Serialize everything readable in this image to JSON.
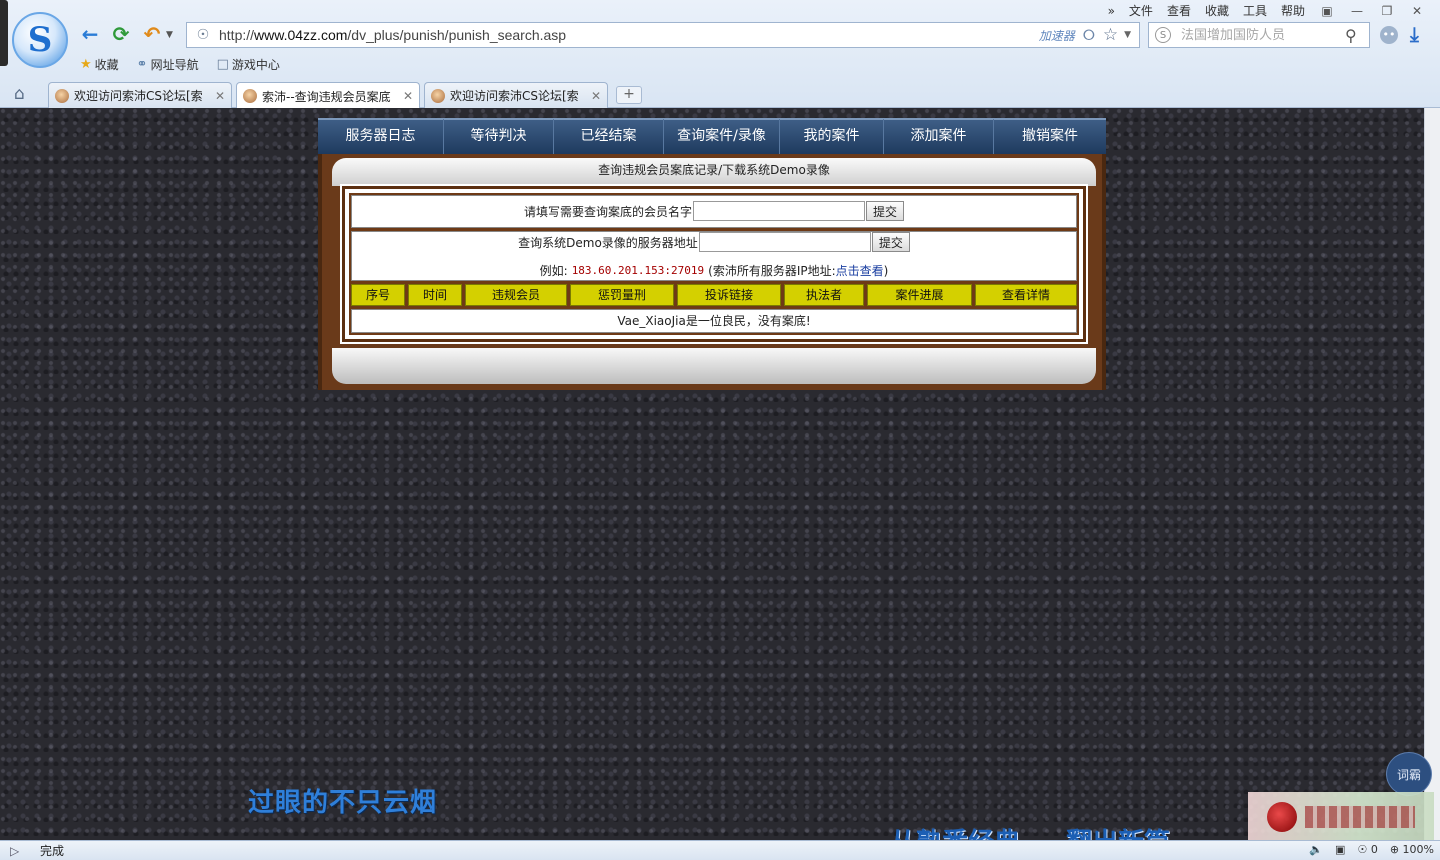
{
  "browser": {
    "url": "http://www.04zz.com/dv_plus/punish/punish_search.asp",
    "url_prefix": "http://",
    "url_host": "www.04zz.com",
    "url_path": "/dv_plus/punish/punish_search.asp",
    "accelerator_label": "加速器",
    "search_placeholder": "法国增加国防人员",
    "menu": [
      "文件",
      "查看",
      "收藏",
      "工具",
      "帮助"
    ],
    "favorites": [
      "收藏",
      "网址导航",
      "游戏中心"
    ],
    "tabs": [
      {
        "title": "欢迎访问索沛CS论坛[索"
      },
      {
        "title": "索沛--查询违规会员案底"
      },
      {
        "title": "欢迎访问索沛CS论坛[索"
      }
    ],
    "status_text": "完成",
    "status_count": "0",
    "zoom": "100%"
  },
  "site": {
    "nav": [
      "服务器日志",
      "等待判决",
      "已经结案",
      "查询案件/录像",
      "我的案件",
      "添加案件",
      "撤销案件"
    ],
    "panel_title": "查询违规会员案底记录/下载系统Demo录像",
    "name_label": "请填写需要查询案底的会员名字",
    "server_label": "查询系统Demo录像的服务器地址",
    "submit_label": "提交",
    "example_prefix": "例如:",
    "example_ip": "183.60.201.153:27019",
    "example_note_open": "(索沛所有服务器IP地址:",
    "example_link": "点击查看",
    "example_note_close": ")",
    "columns": [
      "序号",
      "时间",
      "违规会员",
      "惩罚量刑",
      "投诉链接",
      "执法者",
      "案件进展",
      "查看详情"
    ],
    "result": "Vae_XiaoJia是一位良民，没有案底!"
  },
  "overlay": {
    "lyric_line_1": "过眼的不只云烟",
    "lyric_line_2a": "从熟悉经典",
    "lyric_line_2b": "翻出新篇",
    "lyric_button": "词霸"
  }
}
